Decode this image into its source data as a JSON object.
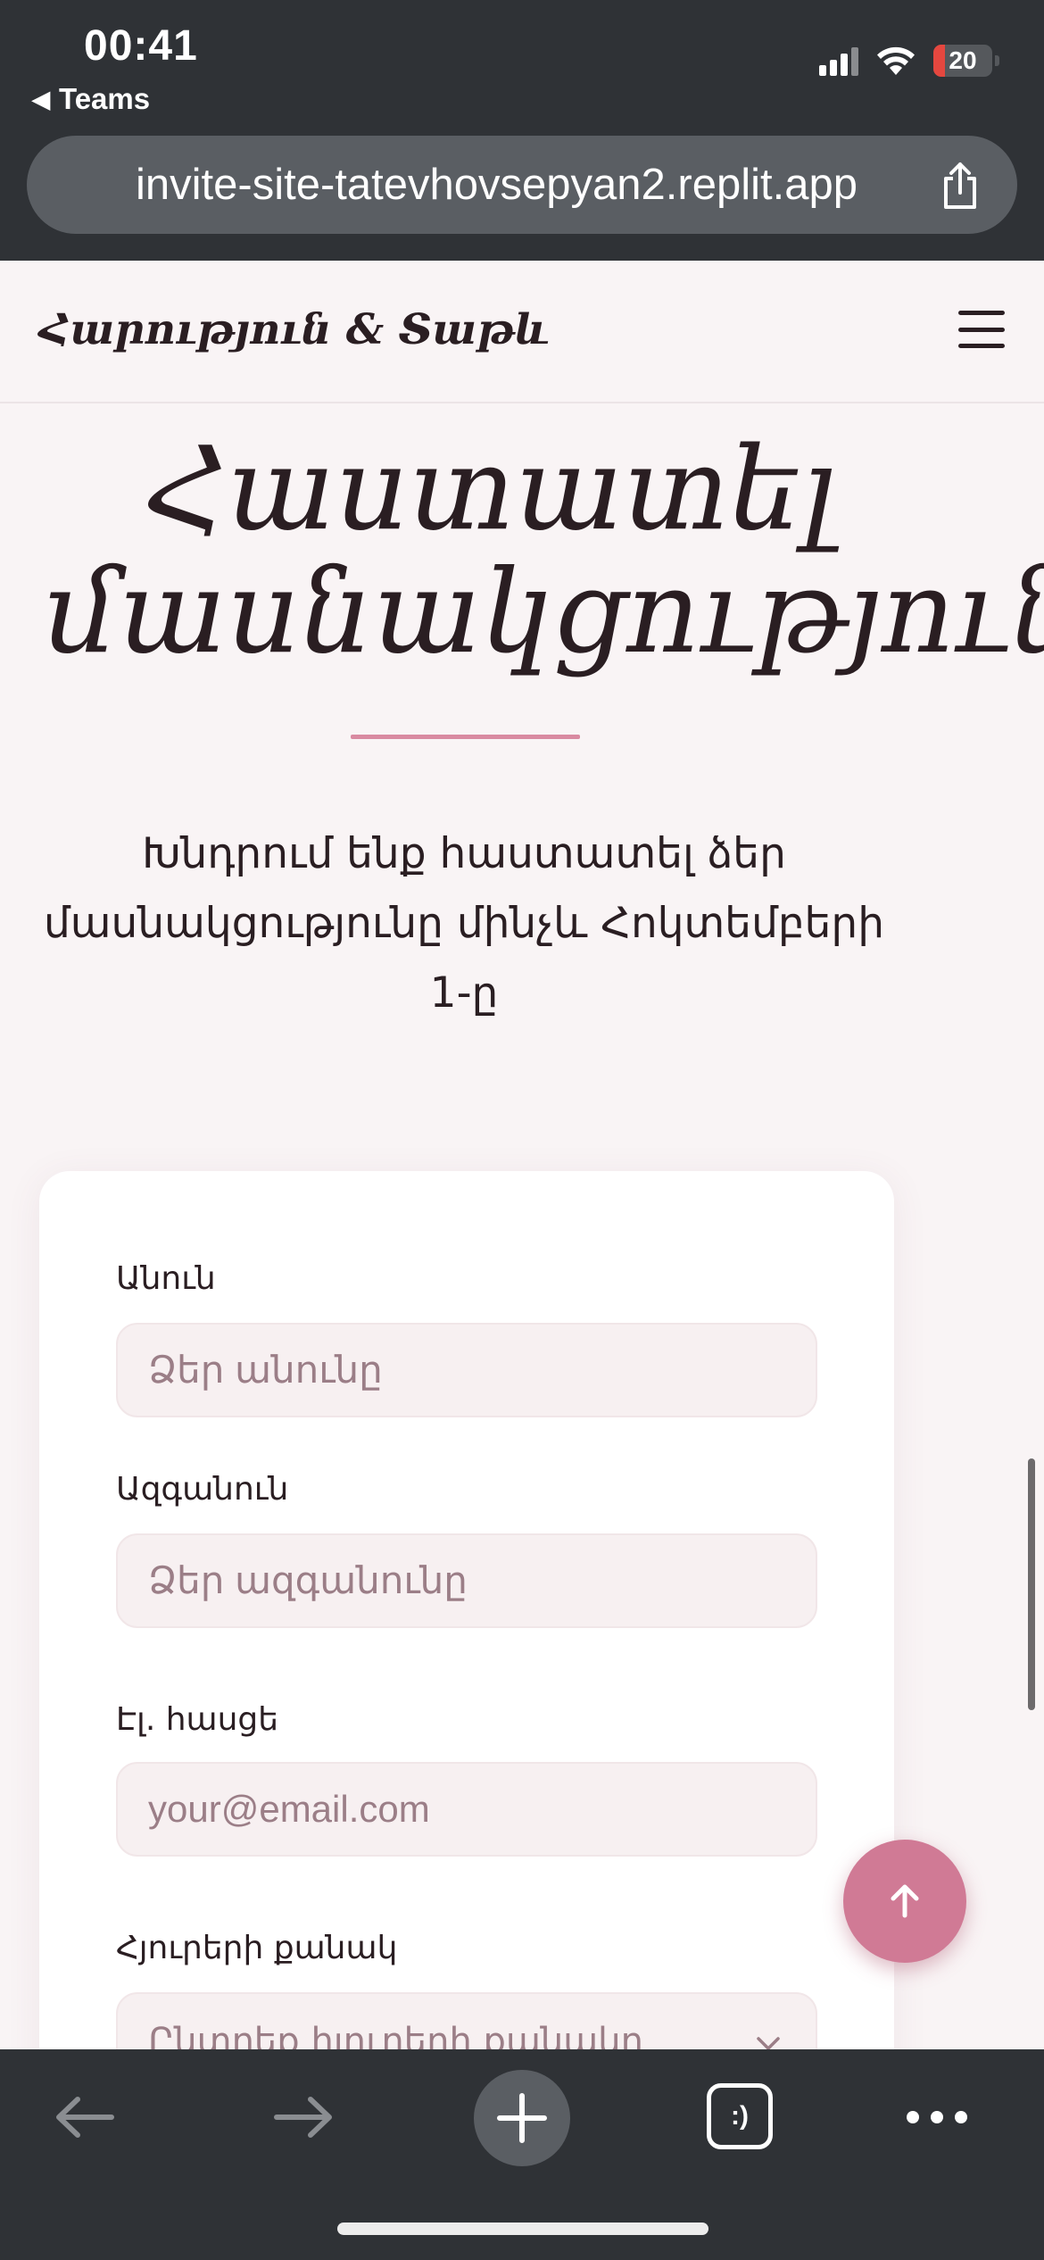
{
  "status_bar": {
    "time": "00:41",
    "back_app": "Teams",
    "battery_level": "20",
    "battery_fraction": 0.2,
    "battery_color": "#e5473f"
  },
  "browser": {
    "url": "invite-site-tatevhovsepyan2.replit.app",
    "share_icon": "share-icon",
    "toolbar_icons": [
      "back-arrow-icon",
      "forward-arrow-icon",
      "new-tab-plus-icon",
      "tabs-icon",
      "more-icon"
    ],
    "tabs_label": ":)"
  },
  "site": {
    "brand": "Հարություն & Տաթև",
    "menu_icon": "hamburger-menu-icon",
    "accent_color": "#d07a95"
  },
  "page": {
    "title_line1": "Հաստատել",
    "title_line2": "մասնակցությունը",
    "subtitle": "Խնդրում ենք հաստատել ձեր մասնակցությունը մինչև Հոկտեմբերի 1-ը"
  },
  "form": {
    "first_name_label": "Անուն",
    "first_name_placeholder": "Ձեր անունը",
    "last_name_label": "Ազգանուն",
    "last_name_placeholder": "Ձեր ազգանունը",
    "email_label": "Էլ. հասցե",
    "email_placeholder": "your@email.com",
    "guests_label": "Հյուրերի քանակ",
    "guests_placeholder": "Ընտրեք հյուրերի քանակը"
  },
  "scroll_top_icon": "arrow-up-icon"
}
